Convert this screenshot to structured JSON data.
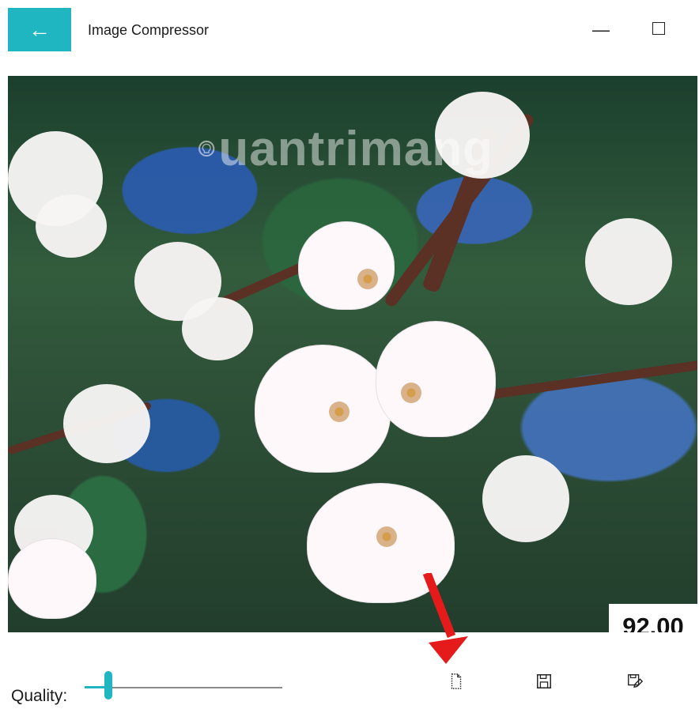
{
  "window": {
    "title": "Image Compressor",
    "back_icon": "arrow-left-icon",
    "minimize_icon": "minimize-icon",
    "maximize_icon": "maximize-icon"
  },
  "image": {
    "watermark": "uantrimang",
    "value_display": "92.00"
  },
  "controls": {
    "quality_label": "Quality:",
    "quality_slider": {
      "level_fraction": 0.12
    },
    "buttons": [
      {
        "name": "new-file-button",
        "icon": "file-icon"
      },
      {
        "name": "save-button",
        "icon": "save-icon"
      },
      {
        "name": "save-as-button",
        "icon": "save-edit-icon"
      }
    ]
  },
  "annotation": {
    "arrow_color": "#e51b1b"
  },
  "colors": {
    "accent": "#1fb5c1",
    "arrow": "#e51b1b"
  }
}
